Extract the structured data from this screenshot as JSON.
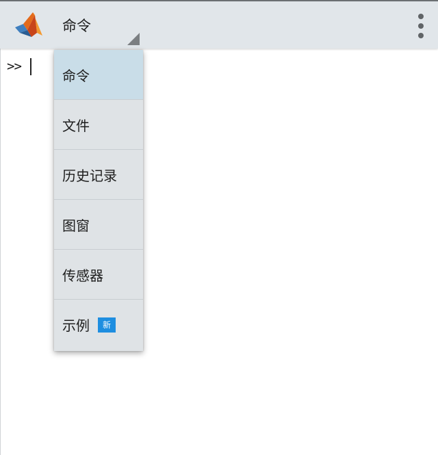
{
  "toolbar": {
    "app_icon": "matlab-logo-icon",
    "view_title": "命令",
    "dropdown_icon": "dropdown-triangle-icon",
    "overflow_icon": "more-vertical-icon"
  },
  "console": {
    "prompt": ">>"
  },
  "menu": {
    "items": [
      {
        "label": "命令",
        "selected": true
      },
      {
        "label": "文件"
      },
      {
        "label": "历史记录"
      },
      {
        "label": "图窗"
      },
      {
        "label": "传感器"
      },
      {
        "label": "示例",
        "badge": "新"
      }
    ]
  },
  "colors": {
    "toolbar_bg": "#e1e6ea",
    "menu_bg": "#dfe3e6",
    "selected_bg": "#c9dde8",
    "badge_bg": "#1e8ee0"
  }
}
